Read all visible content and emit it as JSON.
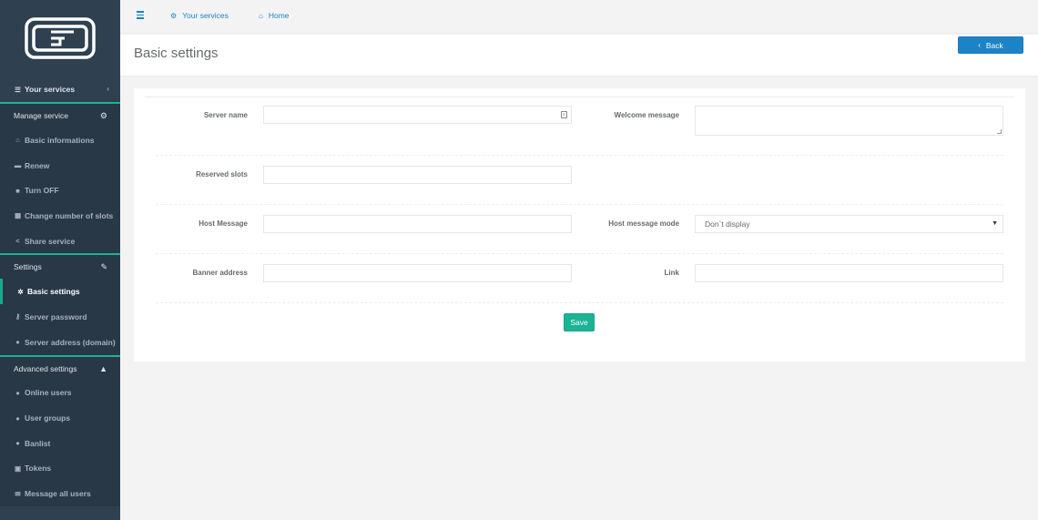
{
  "sidebar": {
    "items": [
      {
        "label": "Your services",
        "icon": "list-icon"
      },
      {
        "label": "Manage service",
        "icon": "cogs-icon"
      },
      {
        "label": "Basic informations",
        "icon": "home-icon"
      },
      {
        "label": "Renew",
        "icon": "cart-icon"
      },
      {
        "label": "Turn OFF",
        "icon": "stop-icon"
      },
      {
        "label": "Change number of slots",
        "icon": "grid-icon"
      },
      {
        "label": "Share service",
        "icon": "share-icon"
      },
      {
        "label": "Settings",
        "icon": "wrench-icon"
      },
      {
        "label": "Basic settings",
        "icon": "gear-icon"
      },
      {
        "label": "Server password",
        "icon": "key-icon"
      },
      {
        "label": "Server address (domain)",
        "icon": "globe-icon"
      },
      {
        "label": "Advanced settings",
        "icon": "warning-icon"
      },
      {
        "label": "Online users",
        "icon": "user-icon"
      },
      {
        "label": "User groups",
        "icon": "users-icon"
      },
      {
        "label": "Banlist",
        "icon": "user-ban-icon"
      },
      {
        "label": "Tokens",
        "icon": "lock-icon"
      },
      {
        "label": "Message all users",
        "icon": "envelope-icon"
      }
    ]
  },
  "topbar": {
    "services_link": "Your services",
    "home_link": "Home"
  },
  "heading": {
    "title": "Basic settings",
    "back_label": "Back"
  },
  "form": {
    "server_name_label": "Server name",
    "server_name_value": "",
    "welcome_message_label": "Welcome message",
    "welcome_message_value": "",
    "reserved_slots_label": "Reserved slots",
    "reserved_slots_value": "",
    "host_message_label": "Host Message",
    "host_message_value": "",
    "host_message_mode_label": "Host message mode",
    "host_message_mode_value": "Don`t display",
    "banner_address_label": "Banner address",
    "banner_address_value": "",
    "link_label": "Link",
    "link_value": "",
    "save_label": "Save"
  },
  "colors": {
    "sidebar_bg": "#2f4050",
    "accent_green": "#1ab394",
    "accent_blue": "#1c84c6"
  }
}
